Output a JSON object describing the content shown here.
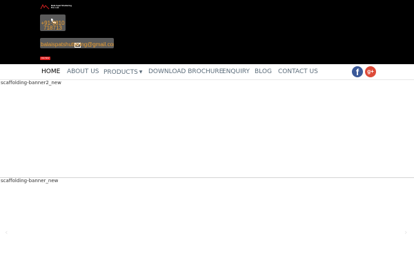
{
  "header": {
    "logo_alt": "Bala Ispat Shuttering Pvt. Ltd.",
    "phone_icon": "phone-icon",
    "phone_number": "+91-9810 718713",
    "email_icon": "envelope-icon",
    "email": "balaispatshuttering@gmail.com",
    "badge_label": "REVIEW"
  },
  "nav": {
    "items": [
      {
        "label": "HOME",
        "active": true
      },
      {
        "label": "ABOUT US"
      },
      {
        "label": "PRODUCTS",
        "has_dropdown": true
      },
      {
        "label": "DOWNLOAD BROCHURE"
      },
      {
        "label": "ENQUIRY"
      },
      {
        "label": "BLOG"
      },
      {
        "label": "CONTACT US"
      }
    ],
    "social": [
      {
        "name": "facebook",
        "glyph": "f",
        "color": "#3b5998"
      },
      {
        "name": "google-plus",
        "glyph": "g+",
        "color": "#dd4b39"
      }
    ]
  },
  "banners": [
    {
      "alt": "scaffolding-banner2_new"
    },
    {
      "alt": "scaffolding-banner_new"
    }
  ],
  "slider": {
    "prev_glyph": "‹",
    "next_glyph": "›"
  },
  "colors": {
    "header_bg": "#000000",
    "contact_box_bg": "#5a5a5a",
    "contact_text": "#f0a030",
    "nav_text": "#5b6c7a",
    "nav_active": "#000000"
  }
}
